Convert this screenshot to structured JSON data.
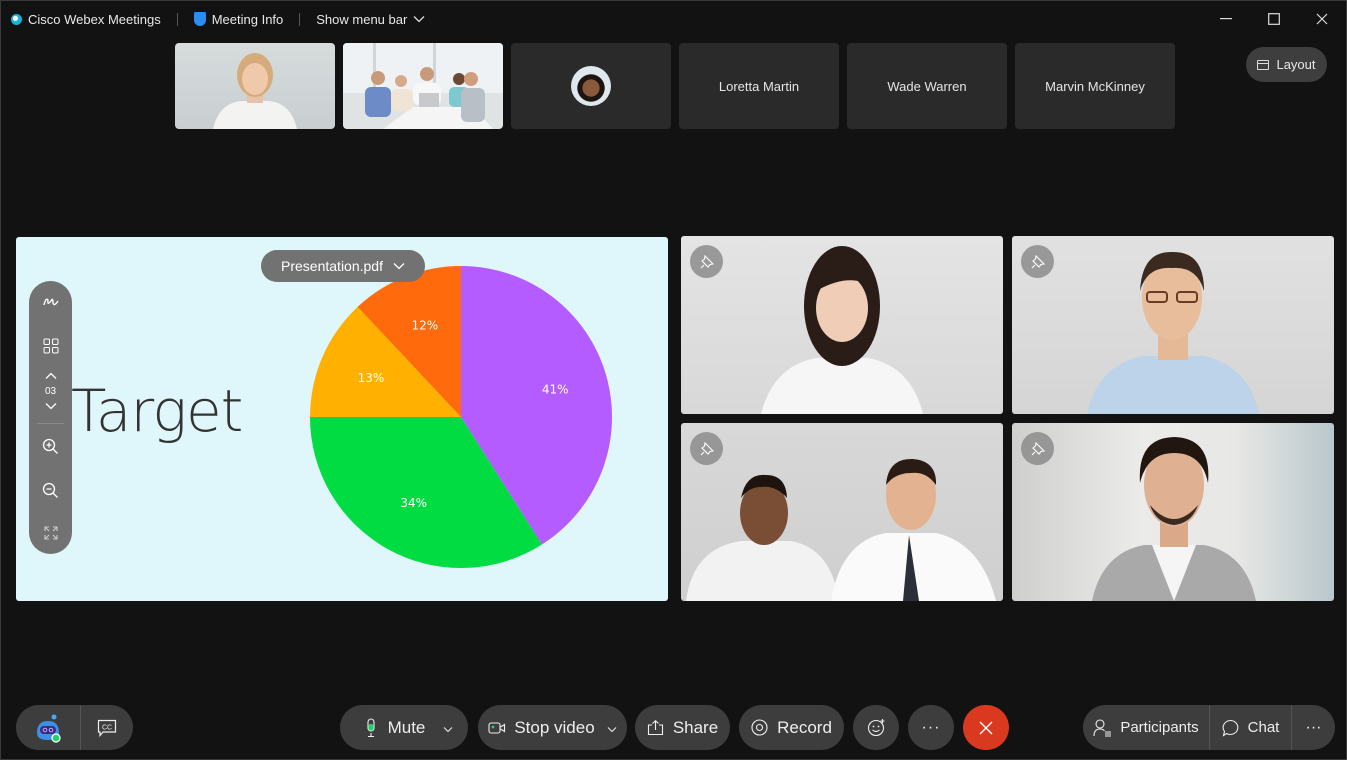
{
  "titlebar": {
    "app_name": "Cisco Webex Meetings",
    "meeting_info": "Meeting Info",
    "show_menu_bar": "Show menu bar",
    "minimize_glyph": "—",
    "maximize_glyph": "☐",
    "close_glyph": "✕"
  },
  "layout_button": {
    "label": "Layout"
  },
  "filmstrip": [
    {
      "type": "video",
      "description": "blonde woman"
    },
    {
      "type": "video",
      "description": "group at table"
    },
    {
      "type": "avatar"
    },
    {
      "type": "name",
      "name": "Loretta Martin"
    },
    {
      "type": "name",
      "name": "Wade Warren"
    },
    {
      "type": "name",
      "name": "Marvin McKinney"
    }
  ],
  "share": {
    "file_name": "Presentation.pdf",
    "page_number": "03",
    "slide_title": "Target",
    "colors": {
      "background": "#dff7fb",
      "rail": "#727272"
    }
  },
  "chart_data": {
    "type": "pie",
    "title": "Target",
    "categories": [
      "Purple",
      "Green",
      "Yellow",
      "Orange"
    ],
    "values": [
      41,
      34,
      13,
      12
    ],
    "labels": [
      "41%",
      "34%",
      "13%",
      "12%"
    ],
    "colors": [
      "#b45cff",
      "#00dc41",
      "#ffb000",
      "#ff6a0d"
    ],
    "start_angle_deg": 0,
    "direction": "clockwise-from-top"
  },
  "video_tiles": [
    {
      "description": "woman dark hair",
      "pin": "pin-icon"
    },
    {
      "description": "man with glasses",
      "pin": "pin-icon"
    },
    {
      "description": "two men in shirts",
      "pin": "pin-icon"
    },
    {
      "description": "man smiling in office",
      "pin": "pin-icon"
    }
  ],
  "controls": {
    "mute": "Mute",
    "stop_video": "Stop video",
    "share": "Share",
    "record": "Record",
    "more_glyph": "···",
    "end_glyph": "✕",
    "participants": "Participants",
    "chat": "Chat",
    "cc": "CC",
    "accent_green": "#1fd46b",
    "end_red": "#d9391f"
  }
}
